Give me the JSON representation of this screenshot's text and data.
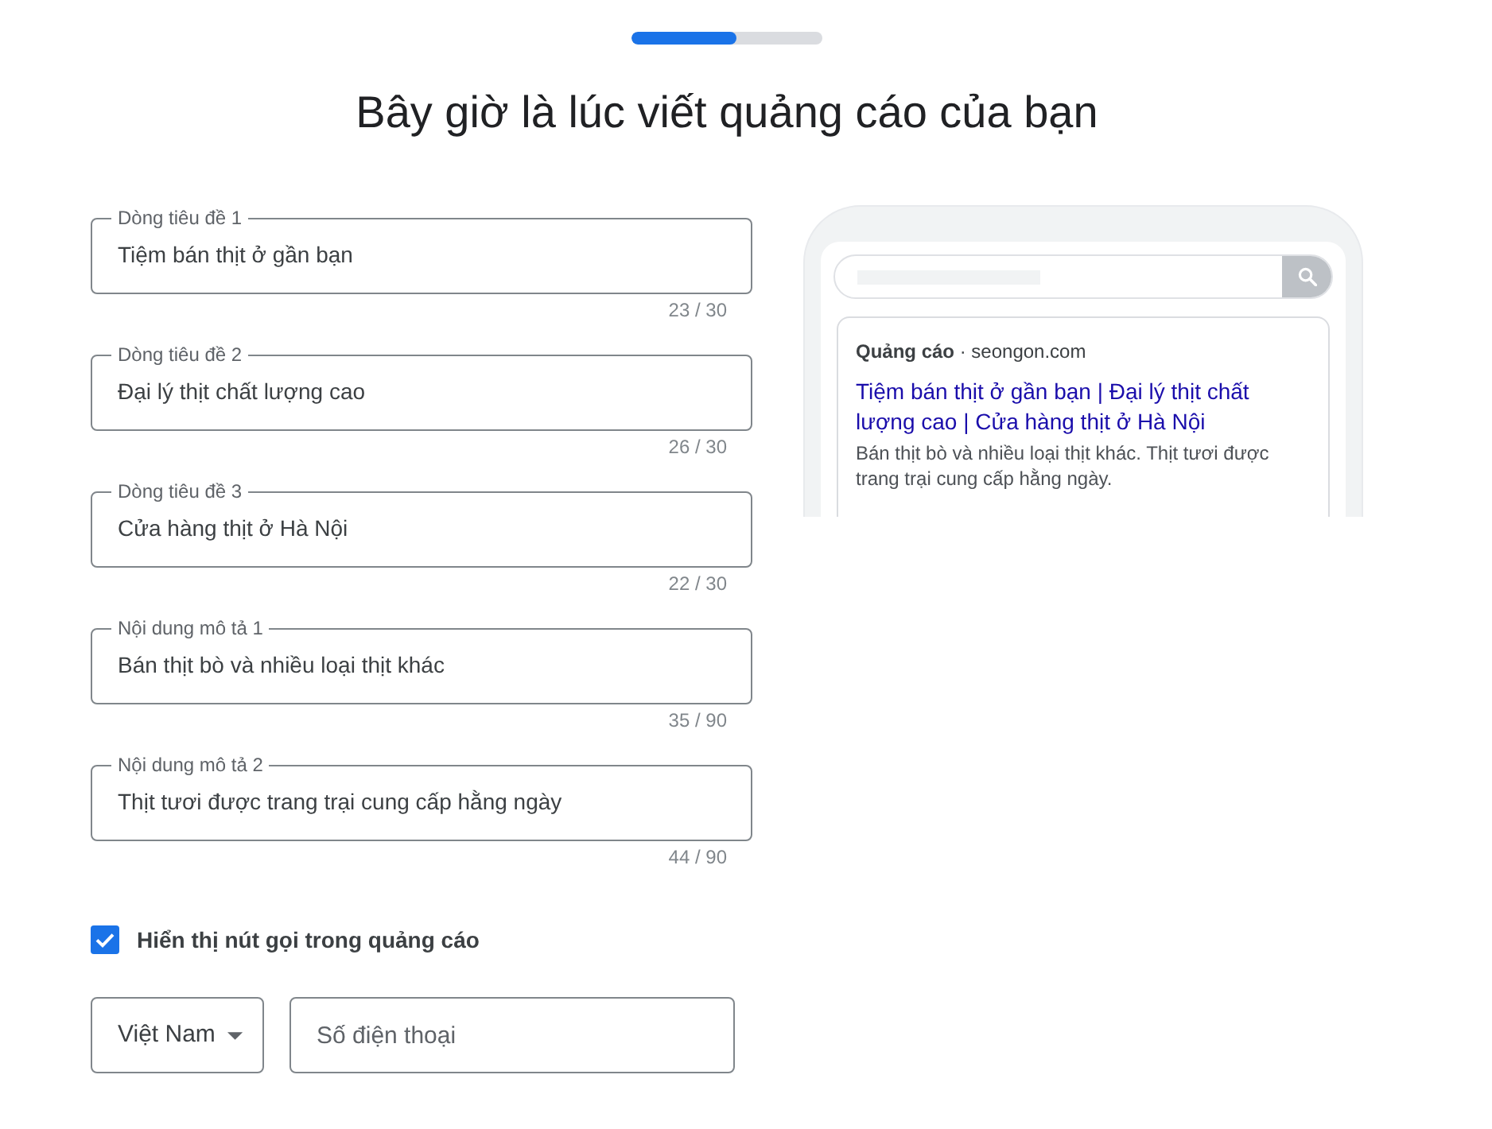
{
  "progress": {
    "level": 0.55
  },
  "title": "Bây giờ là lúc viết quảng cáo của bạn",
  "fields": [
    {
      "label": "Dòng tiêu đề 1",
      "value": "Tiệm bán thịt ở gần bạn",
      "counter": "23 / 30"
    },
    {
      "label": "Dòng tiêu đề 2",
      "value": "Đại lý thịt chất lượng cao",
      "counter": "26 / 30"
    },
    {
      "label": "Dòng tiêu đề 3",
      "value": "Cửa hàng thịt ở Hà Nội",
      "counter": "22 / 30"
    },
    {
      "label": "Nội dung mô tả 1",
      "value": "Bán thịt bò và nhiều loại thịt khác",
      "counter": "35 / 90"
    },
    {
      "label": "Nội dung mô tả 2",
      "value": "Thịt tươi được trang trại cung cấp hằng ngày",
      "counter": "44 / 90"
    }
  ],
  "call_option": {
    "label": "Hiển thị nút gọi trong quảng cáo",
    "checked": true
  },
  "country_select": {
    "value": "Việt Nam"
  },
  "phone_field": {
    "placeholder": "Số điện thoại"
  },
  "ad_preview": {
    "source": "**Quảng cáo** · seongon.com",
    "headline": "Tiệm bán thịt ở gần bạn | Đại lý thịt chất lượng cao | Cửa hàng thịt ở Hà Nội",
    "description": "Bán thịt bò và nhiều loại thịt khác. Thịt tươi được trang trại cung cấp hằng ngày."
  }
}
